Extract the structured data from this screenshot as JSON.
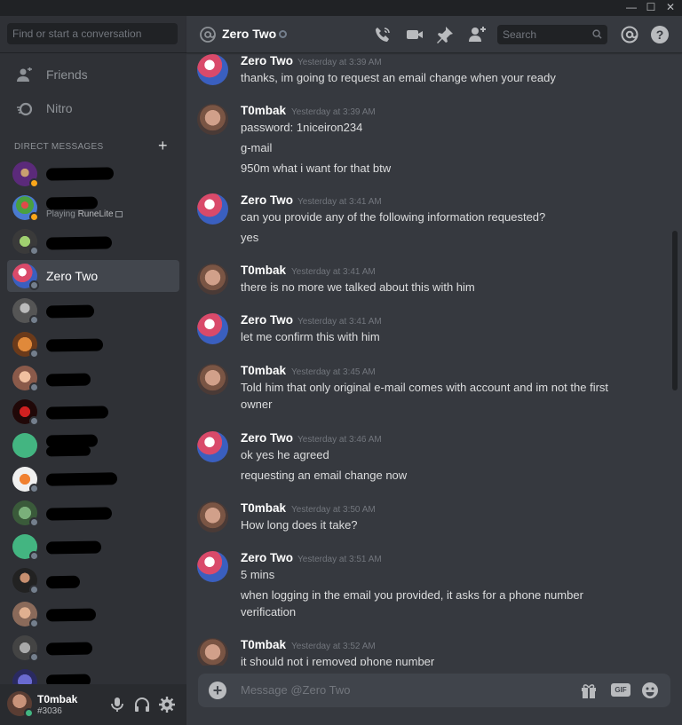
{
  "window": {
    "minimize": "—",
    "maximize": "☐",
    "close": "✕"
  },
  "sidebar": {
    "search_placeholder": "Find or start a conversation",
    "nav": [
      {
        "label": "Friends"
      },
      {
        "label": "Nitro"
      }
    ],
    "dm_header": "DIRECT MESSAGES",
    "dm_add": "+",
    "active_dm": {
      "name": "Zero Two"
    },
    "playing": {
      "prefix": "Playing ",
      "game": "RuneLite"
    }
  },
  "user": {
    "name": "T0mbak",
    "tag": "#3036"
  },
  "channel": {
    "title": "Zero Two",
    "search_placeholder": "Search"
  },
  "messages": [
    {
      "author": "Zero Two",
      "time": "Yesterday at 3:39 AM",
      "lines": [
        "thanks, im going to request an email change when your ready"
      ]
    },
    {
      "author": "T0mbak",
      "time": "Yesterday at 3:39 AM",
      "lines": [
        "password: 1niceiron234",
        "g-mail",
        "950m what i want for that btw"
      ]
    },
    {
      "author": "Zero Two",
      "time": "Yesterday at 3:41 AM",
      "lines": [
        "can you provide any of the following information requested?",
        "yes"
      ]
    },
    {
      "author": "T0mbak",
      "time": "Yesterday at 3:41 AM",
      "lines": [
        "there is no more we talked about this with him"
      ]
    },
    {
      "author": "Zero Two",
      "time": "Yesterday at 3:41 AM",
      "lines": [
        "let me confirm this with him"
      ]
    },
    {
      "author": "T0mbak",
      "time": "Yesterday at 3:45 AM",
      "lines": [
        "Told him that only original e-mail comes with account and im not the first",
        "owner"
      ]
    },
    {
      "author": "Zero Two",
      "time": "Yesterday at 3:46 AM",
      "lines": [
        "ok yes he agreed",
        "requesting an email change now"
      ]
    },
    {
      "author": "T0mbak",
      "time": "Yesterday at 3:50 AM",
      "lines": [
        "How long does it take?"
      ]
    },
    {
      "author": "Zero Two",
      "time": "Yesterday at 3:51 AM",
      "lines": [
        "5 mins",
        "when logging in the email you provided, it asks for a phone number",
        "verification"
      ]
    },
    {
      "author": "T0mbak",
      "time": "Yesterday at 3:52 AM",
      "lines": [
        "it should not i removed phone number"
      ]
    }
  ],
  "composer": {
    "placeholder": "Message @Zero Two",
    "gif": "GIF"
  }
}
